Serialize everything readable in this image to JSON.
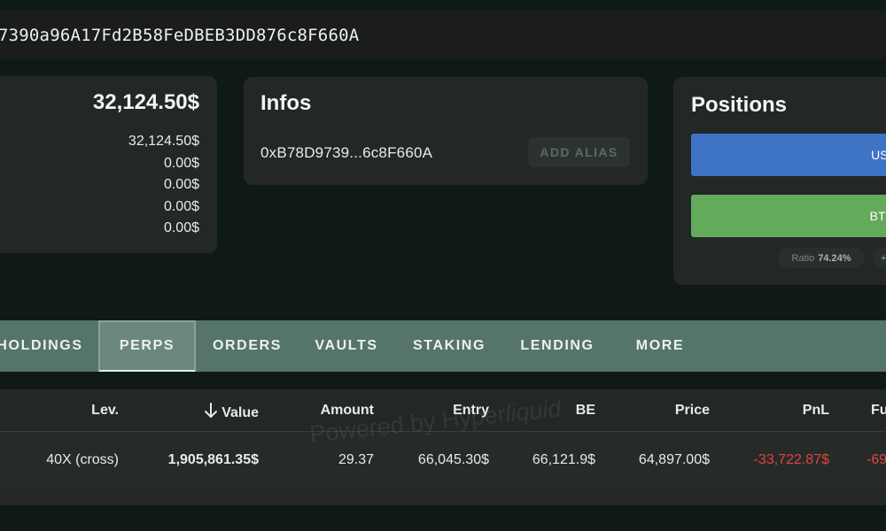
{
  "address_bar": {
    "address": "7390a96A17Fd2B58FeDBEB3DD876c8F660A"
  },
  "balance_card": {
    "total": "32,124.50$",
    "rows": [
      "32,124.50$",
      "0.00$",
      "0.00$",
      "0.00$",
      "0.00$"
    ]
  },
  "infos_card": {
    "title": "Infos",
    "address_short": "0xB78D9739...6c8F660A",
    "add_alias_label": "ADD ALIAS"
  },
  "positions_card": {
    "title": "Positions",
    "bars": [
      {
        "label": "USDC",
        "color": "#3e73c6"
      },
      {
        "label": "BTC-U",
        "color": "#63aa5a"
      }
    ],
    "ratio_label": "Ratio",
    "ratio_value": "74.24%",
    "plus_chip": "+"
  },
  "tabs": [
    {
      "label": "HOLDINGS",
      "active": false
    },
    {
      "label": "PERPS",
      "active": true
    },
    {
      "label": "ORDERS",
      "active": false
    },
    {
      "label": "VAULTS",
      "active": false
    },
    {
      "label": "STAKING",
      "active": false
    },
    {
      "label": "LENDING",
      "active": false
    },
    {
      "label": "MORE",
      "active": false
    }
  ],
  "table": {
    "headers": {
      "lev": "Lev.",
      "value": "Value",
      "amount": "Amount",
      "entry": "Entry",
      "be": "BE",
      "price": "Price",
      "pnl": "PnL",
      "funding": "Fu"
    },
    "sort_icon": "arrow-down-icon",
    "rows": [
      {
        "lev": "40X (cross)",
        "value": "1,905,861.35$",
        "amount": "29.37",
        "entry": "66,045.30$",
        "be": "66,121.9$",
        "price": "64,897.00$",
        "pnl": "-33,722.87$",
        "funding": "-69"
      }
    ]
  },
  "watermark": {
    "prefix": "Powered by Hyper",
    "suffix": "liquid"
  },
  "colors": {
    "background": "#0f1a17",
    "card": "#232726",
    "tab_bar": "#55746c",
    "negative": "#e1453b",
    "usdc_bar": "#3e73c6",
    "btc_bar": "#63aa5a"
  }
}
